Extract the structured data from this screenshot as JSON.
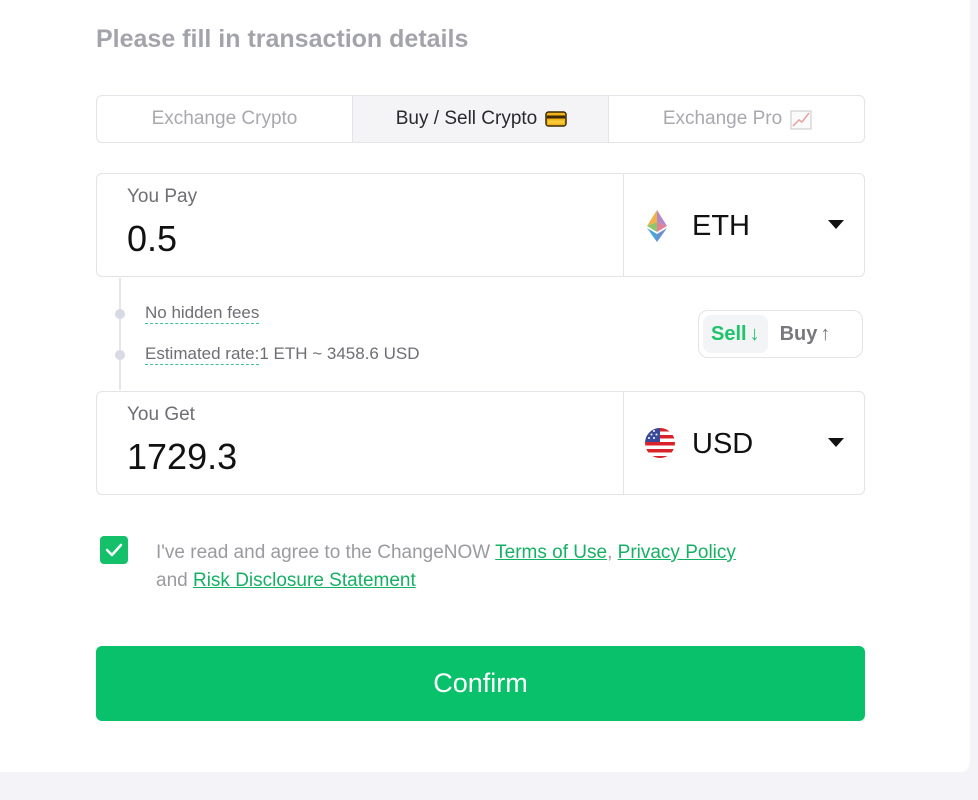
{
  "header": {
    "title": "Please fill in transaction details"
  },
  "tabs": [
    {
      "label": "Exchange Crypto",
      "icon": "",
      "active": false
    },
    {
      "label": "Buy / Sell Crypto",
      "icon": "credit-card-icon",
      "active": true
    },
    {
      "label": "Exchange Pro",
      "icon": "chart-increasing-icon",
      "active": false
    }
  ],
  "pay": {
    "label": "You Pay",
    "amount": "0.5",
    "currency": {
      "code": "ETH",
      "icon": "ethereum-icon"
    }
  },
  "info": {
    "no_fees": "No hidden fees",
    "rate_label": "Estimated rate:",
    "rate_value": "1 ETH ~ 3458.6 USD"
  },
  "mode_toggle": {
    "options": [
      {
        "label": "Sell",
        "arrow": "↓",
        "active": true
      },
      {
        "label": "Buy",
        "arrow": "↑",
        "active": false
      }
    ]
  },
  "get": {
    "label": "You Get",
    "amount": "1729.3",
    "currency": {
      "code": "USD",
      "icon": "us-flag-icon"
    }
  },
  "agreement": {
    "checked": true,
    "prefix": "I've read and agree to the ChangeNOW ",
    "terms": "Terms of Use",
    "comma": ", ",
    "privacy": "Privacy Policy",
    "and": "and ",
    "risk": "Risk Disclosure Statement"
  },
  "confirm_label": "Confirm",
  "colors": {
    "accent": "#08c16a",
    "link": "#16b065",
    "title": "#a3a3ab",
    "page_bg": "#f4f3f8"
  }
}
